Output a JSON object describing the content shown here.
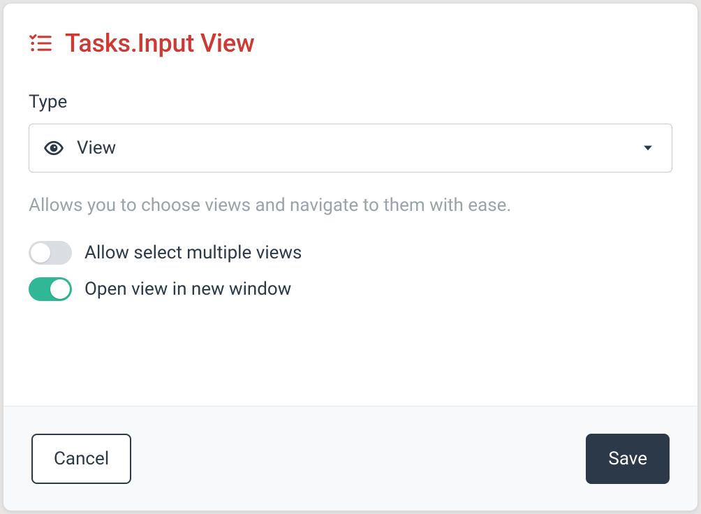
{
  "title": "Tasks.Input View",
  "field": {
    "label": "Type",
    "selected": "View",
    "helper": "Allows you to choose views and navigate to them with ease."
  },
  "toggles": {
    "allow_multiple": {
      "label": "Allow select multiple views",
      "on": false
    },
    "open_new_window": {
      "label": "Open view in new window",
      "on": true
    }
  },
  "footer": {
    "cancel": "Cancel",
    "save": "Save"
  }
}
